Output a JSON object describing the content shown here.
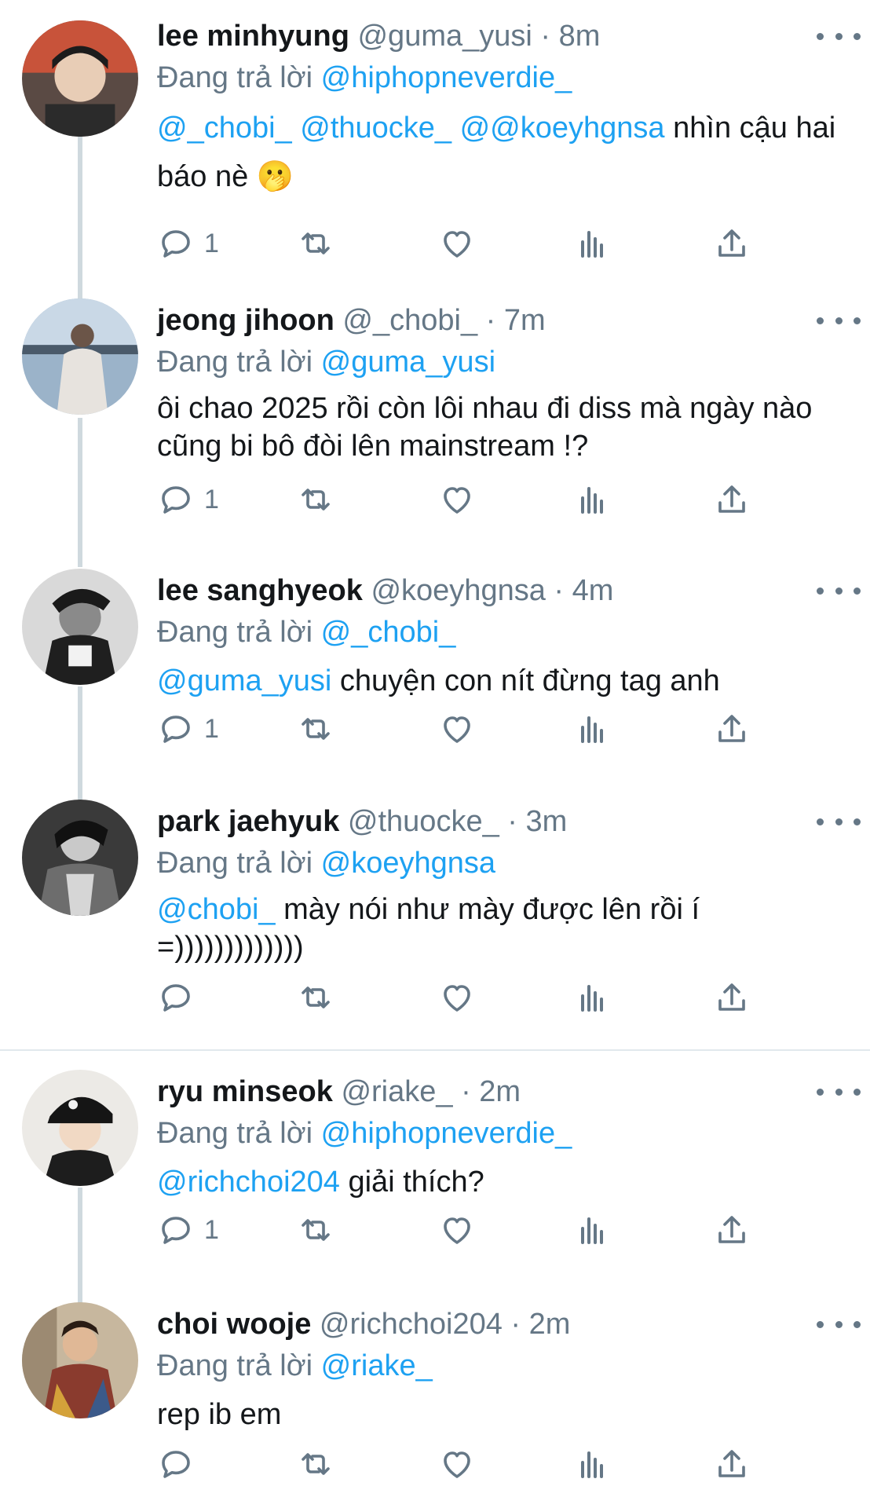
{
  "replying_label": "Đang trả lời",
  "more_icon": "more-horizontal-icon",
  "colors": {
    "mention": "#1da1f2",
    "secondary": "#657786",
    "primary": "#14171a",
    "thread_line": "#cfd9de"
  },
  "tweets": [
    {
      "name": "lee minhyung",
      "handle": "@guma_yusi",
      "dot": "·",
      "time": "8m",
      "replying_to": "@hiphopneverdie_",
      "body_segments": [
        {
          "text": "@_chobi_ @thuocke_ @@koeyhgnsa",
          "mention": true
        },
        {
          "text": " nhìn cậu hai báo nè 🫢",
          "mention": false
        }
      ],
      "reply_count": "1"
    },
    {
      "name": "jeong jihoon",
      "handle": "@_chobi_",
      "dot": "·",
      "time": "7m",
      "replying_to": "@guma_yusi",
      "body_segments": [
        {
          "text": "ôi chao 2025 rồi còn lôi nhau đi diss mà ngày nào cũng bi bô đòi lên mainstream !?",
          "mention": false
        }
      ],
      "reply_count": "1"
    },
    {
      "name": "lee sanghyeok",
      "handle": "@koeyhgnsa",
      "dot": "·",
      "time": "4m",
      "replying_to": "@_chobi_",
      "body_segments": [
        {
          "text": "@guma_yusi",
          "mention": true
        },
        {
          "text": " chuyện con nít đừng tag anh",
          "mention": false
        }
      ],
      "reply_count": "1"
    },
    {
      "name": "park jaehyuk",
      "handle": "@thuocke_",
      "dot": "·",
      "time": "3m",
      "replying_to": "@koeyhgnsa",
      "body_segments": [
        {
          "text": "@chobi_",
          "mention": true
        },
        {
          "text": " mày nói như mày được lên rồi í =)))))))))))))",
          "mention": false
        }
      ],
      "reply_count": ""
    },
    {
      "name": "ryu minseok",
      "handle": "@riake_",
      "dot": "·",
      "time": "2m",
      "replying_to": "@hiphopneverdie_",
      "body_segments": [
        {
          "text": "@richchoi204",
          "mention": true
        },
        {
          "text": " giải thích?",
          "mention": false
        }
      ],
      "reply_count": "1"
    },
    {
      "name": "choi wooje",
      "handle": "@richchoi204",
      "dot": "·",
      "time": "2m",
      "replying_to": "@riake_",
      "body_segments": [
        {
          "text": "rep ib em",
          "mention": false
        }
      ],
      "reply_count": ""
    }
  ],
  "action_icons": [
    "reply-icon",
    "retweet-icon",
    "like-icon",
    "views-icon",
    "share-icon"
  ]
}
